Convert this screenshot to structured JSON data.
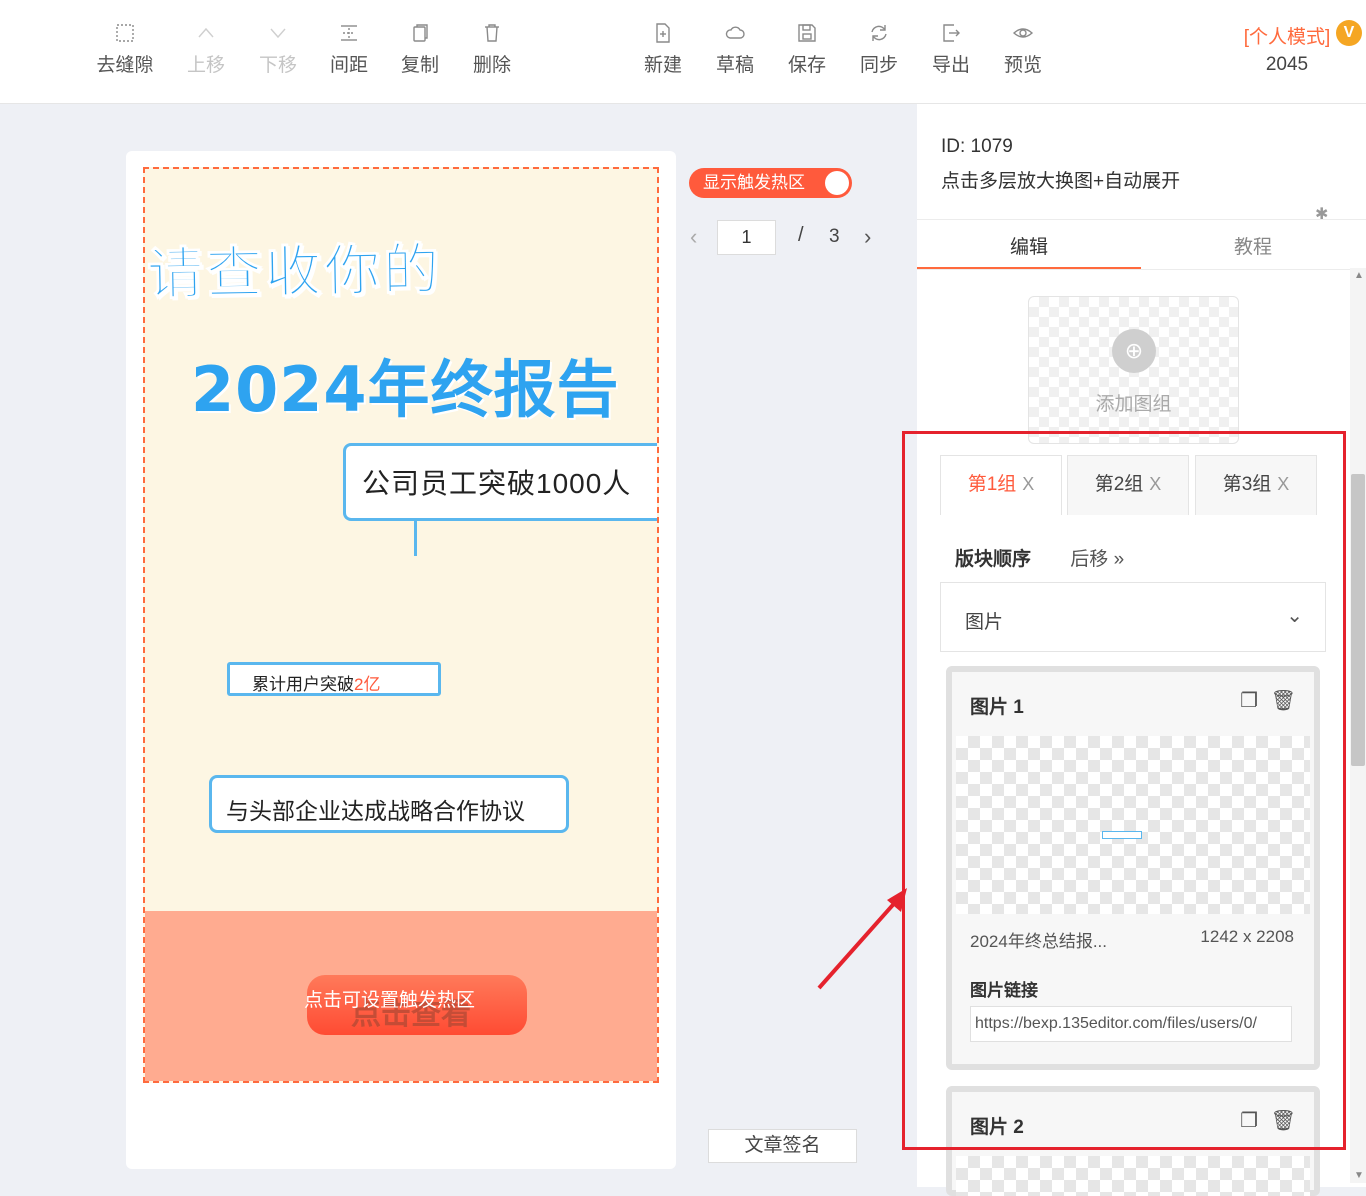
{
  "toolbar": {
    "left_tools": [
      {
        "label": "去缝隙",
        "icon": "dotted-square-icon"
      },
      {
        "label": "上移",
        "icon": "chevron-up-icon"
      },
      {
        "label": "下移",
        "icon": "chevron-down-icon"
      },
      {
        "label": "间距",
        "icon": "spacing-icon"
      },
      {
        "label": "复制",
        "icon": "copy-icon"
      },
      {
        "label": "删除",
        "icon": "trash-icon"
      }
    ],
    "right_tools": [
      {
        "label": "新建",
        "icon": "new-file-icon"
      },
      {
        "label": "草稿",
        "icon": "cloud-icon"
      },
      {
        "label": "保存",
        "icon": "save-icon"
      },
      {
        "label": "同步",
        "icon": "sync-icon"
      },
      {
        "label": "导出",
        "icon": "export-icon"
      },
      {
        "label": "预览",
        "icon": "eye-icon"
      }
    ],
    "mode_label": "[个人模式]",
    "vip_badge": "V",
    "mode_number": "2045"
  },
  "poster": {
    "title_line1": "请查收你的",
    "title_line2": "2024年终报告",
    "bubble1": "公司员工突破1000人",
    "bubble2_prefix": "累计用户突破",
    "bubble2_highlight": "2亿",
    "bubble3": "与头部企业达成战略合作协议",
    "cta_underlay": "点击查看",
    "cta_overlay": "点击可设置触发热区"
  },
  "controls": {
    "hot_toggle_label": "显示触发热区",
    "page_current": "1",
    "page_separator": "/",
    "page_total": "3",
    "sign_button": "文章签名"
  },
  "panel": {
    "id_text": "ID: 1079",
    "name_text": "点击多层放大换图+自动展开",
    "tab_edit": "编辑",
    "tab_tutorial": "教程",
    "add_group_label": "添加图组",
    "groups": [
      {
        "label": "第1组",
        "close": "X"
      },
      {
        "label": "第2组",
        "close": "X"
      },
      {
        "label": "第3组",
        "close": "X"
      }
    ],
    "order_label": "版块顺序",
    "move_back_label": "后移 »",
    "type_value": "图片",
    "image_cards": [
      {
        "title": "图片 1",
        "file_name": "2024年终总结报...",
        "file_size": "1242 x 2208",
        "link_label": "图片链接",
        "link_value": "https://bexp.135editor.com/files/users/0/"
      },
      {
        "title": "图片 2"
      }
    ]
  },
  "colors": {
    "accent": "#ff5a3c",
    "annotation_red": "#e5222d",
    "title_blue": "#2ea3f0"
  }
}
